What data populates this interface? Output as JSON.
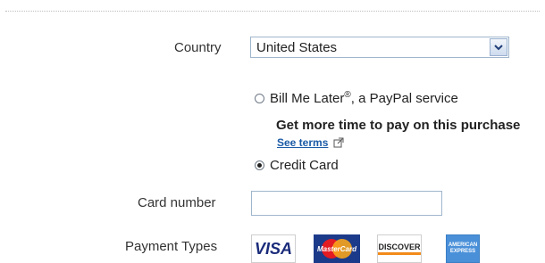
{
  "form": {
    "country_label": "Country",
    "country_value": "United States",
    "option_bml_label": "Bill Me Later",
    "option_bml_reg": "®",
    "option_bml_suffix": ", a PayPal service",
    "bml_promo": "Get more time to pay on this purchase",
    "bml_terms_link": "See terms",
    "option_cc_label": "Credit Card",
    "selected_option": "Credit Card",
    "card_number_label": "Card number",
    "card_number_value": "",
    "payment_types_label": "Payment Types",
    "payment_types": [
      {
        "name": "VISA",
        "icon": "visa-logo"
      },
      {
        "name": "MasterCard",
        "icon": "mastercard-logo"
      },
      {
        "name": "DISCOVER",
        "icon": "discover-logo"
      },
      {
        "name": "AMERICAN EXPRESS",
        "icon": "amex-logo"
      }
    ]
  },
  "colors": {
    "link": "#1a5aa6",
    "field_border": "#9fb6cd",
    "mastercard_bg": "#1c3a8a",
    "amex_bg": "#4a90d9"
  }
}
